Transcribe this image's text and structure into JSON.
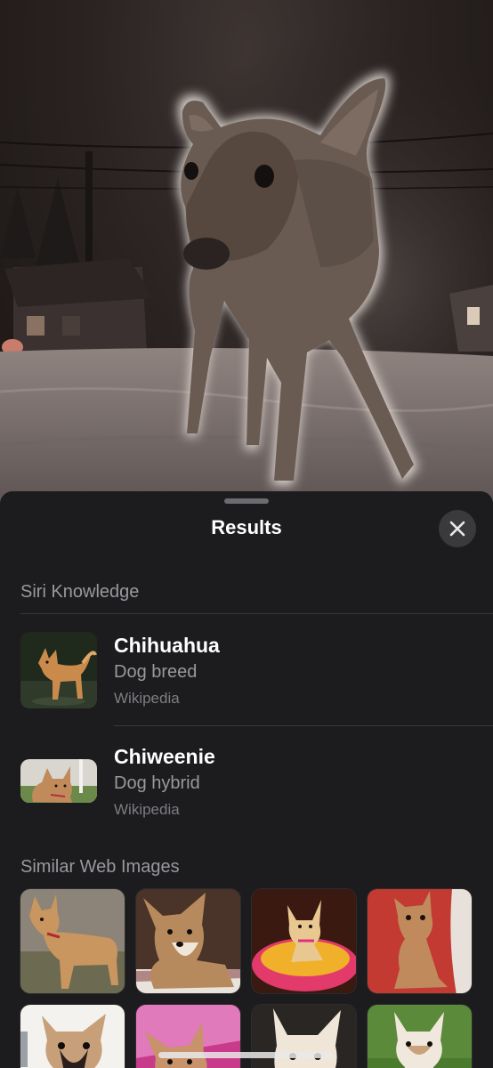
{
  "sheet": {
    "title": "Results"
  },
  "icons": {
    "close": "close-icon",
    "grabber": "grabber-handle"
  },
  "siri_knowledge": {
    "header": "Siri Knowledge",
    "results": [
      {
        "title": "Chihuahua",
        "subtitle": "Dog breed",
        "source": "Wikipedia"
      },
      {
        "title": "Chiweenie",
        "subtitle": "Dog hybrid",
        "source": "Wikipedia"
      }
    ]
  },
  "similar_web_images": {
    "header": "Similar Web Images"
  },
  "colors": {
    "sheet_background": "#1c1c1e",
    "secondary_text": "#98989f",
    "close_button": "#3a3a3c"
  }
}
